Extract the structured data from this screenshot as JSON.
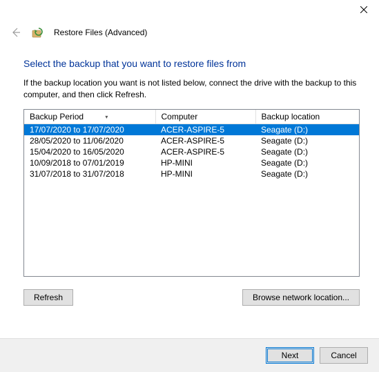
{
  "window": {
    "title": "Restore Files (Advanced)"
  },
  "heading": "Select the backup that you want to restore files from",
  "description": "If the backup location you want is not listed below, connect the drive with the backup to this computer, and then click Refresh.",
  "columns": {
    "period": "Backup Period",
    "computer": "Computer",
    "location": "Backup location"
  },
  "rows": [
    {
      "period": "17/07/2020 to 17/07/2020",
      "computer": "ACER-ASPIRE-5",
      "location": "Seagate (D:)",
      "selected": true
    },
    {
      "period": "28/05/2020 to 11/06/2020",
      "computer": "ACER-ASPIRE-5",
      "location": "Seagate (D:)",
      "selected": false
    },
    {
      "period": "15/04/2020 to 16/05/2020",
      "computer": "ACER-ASPIRE-5",
      "location": "Seagate (D:)",
      "selected": false
    },
    {
      "period": "10/09/2018 to 07/01/2019",
      "computer": "HP-MINI",
      "location": "Seagate (D:)",
      "selected": false
    },
    {
      "period": "31/07/2018 to 31/07/2018",
      "computer": "HP-MINI",
      "location": "Seagate (D:)",
      "selected": false
    }
  ],
  "buttons": {
    "refresh": "Refresh",
    "browse": "Browse network location...",
    "next": "Next",
    "cancel": "Cancel"
  }
}
